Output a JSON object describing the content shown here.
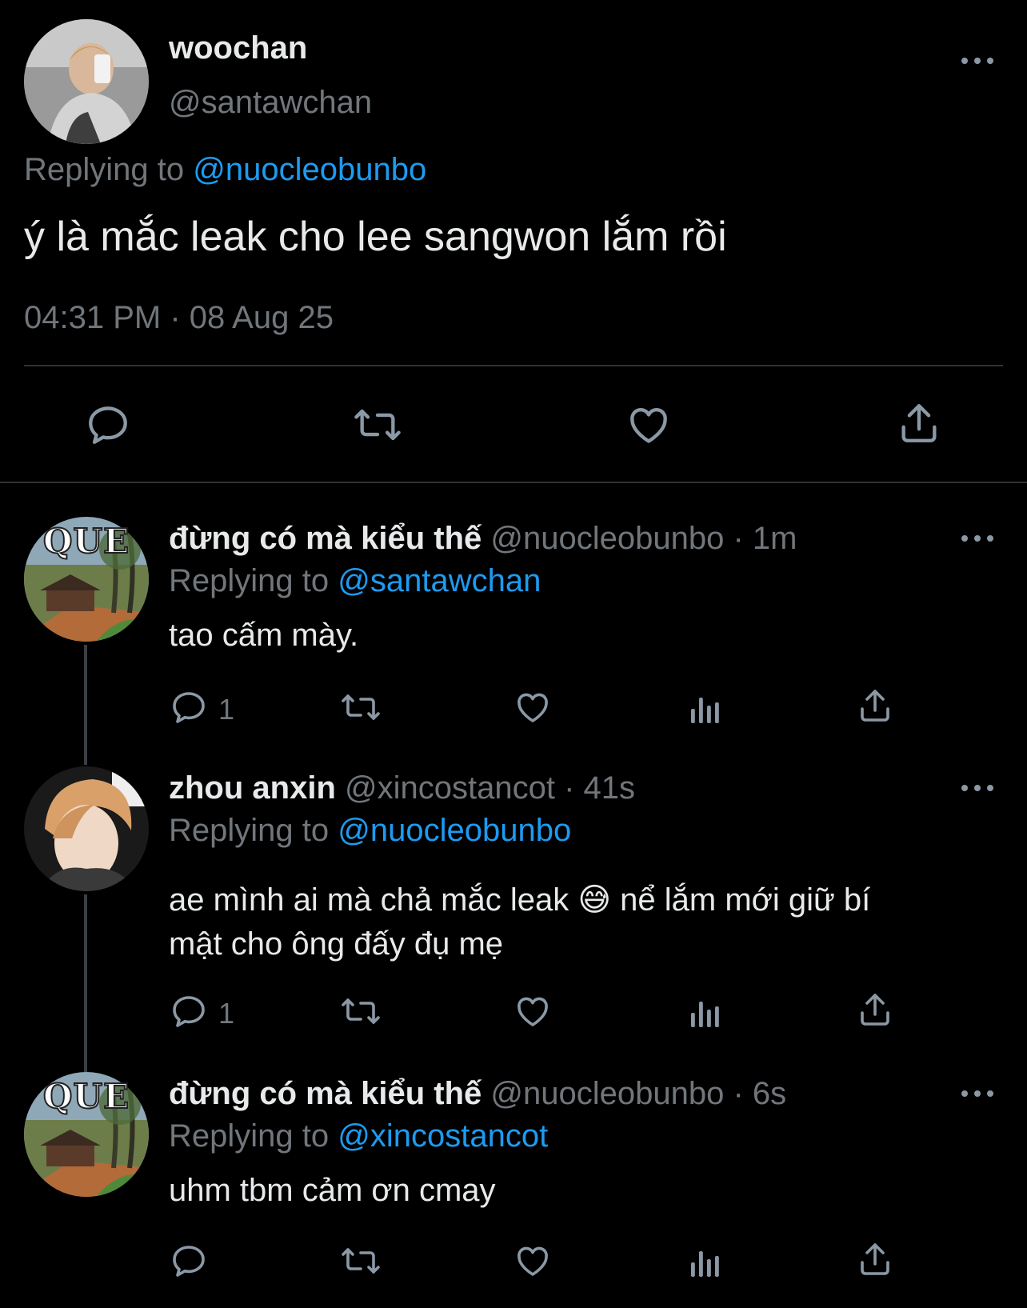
{
  "main_tweet": {
    "display_name": "woochan",
    "handle": "@santawchan",
    "replying_prefix": "Replying to",
    "replying_to": "@nuocleobunbo",
    "text": "ý là mắc leak cho lee sangwon lắm rồi",
    "timestamp": "04:31 PM · 08 Aug 25"
  },
  "replies": [
    {
      "display_name": "đừng có mà kiểu thế",
      "meta": "@nuocleobunbo · 1m",
      "replying_prefix": "Replying to",
      "replying_to": "@santawchan",
      "text": "tao cấm mày.",
      "reply_count": "1",
      "avatar_caption": "QUE"
    },
    {
      "display_name": "zhou anxin",
      "meta": "@xincostancot · 41s",
      "replying_prefix": "Replying to",
      "replying_to": "@nuocleobunbo",
      "text_line1": "ae mình ai mà chả mắc leak 😅  nể lắm mới giữ bí",
      "text_line2": "mật cho ông đấy đụ mẹ",
      "reply_count": "1"
    },
    {
      "display_name": "đừng có mà kiểu thế",
      "meta": "@nuocleobunbo · 6s",
      "replying_prefix": "Replying to",
      "replying_to": "@xincostancot",
      "text": "uhm tbm cảm ơn cmay",
      "avatar_caption": "QUE"
    }
  ],
  "icons": [
    "reply-icon",
    "retweet-icon",
    "like-icon",
    "share-icon",
    "views-icon",
    "more-icon"
  ],
  "colors": {
    "background": "#000000",
    "text": "#e7e9ea",
    "muted": "#71767b",
    "link": "#1d9bf0",
    "divider": "#2f3336"
  }
}
